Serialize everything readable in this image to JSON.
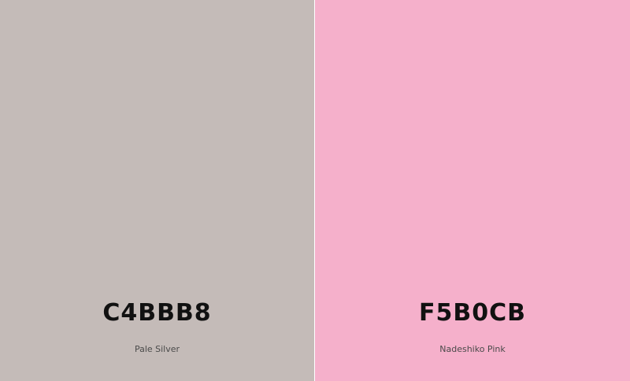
{
  "swatches": [
    {
      "hex": "C4BBB8",
      "name": "Pale Silver",
      "color": "#C4BBB8"
    },
    {
      "hex": "F5B0CB",
      "name": "Nadeshiko Pink",
      "color": "#F5B0CB"
    }
  ]
}
